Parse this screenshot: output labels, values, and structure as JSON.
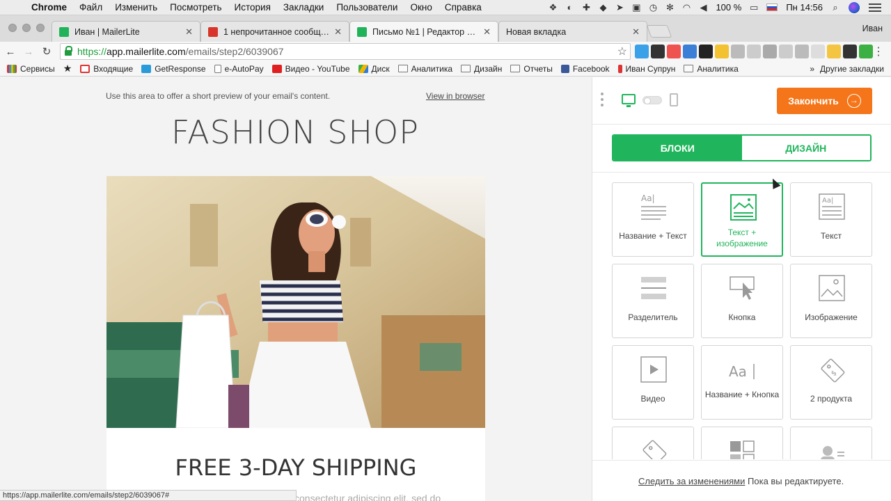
{
  "menubar": {
    "app": "Chrome",
    "items": [
      "Файл",
      "Изменить",
      "Посмотреть",
      "История",
      "Закладки",
      "Пользователи",
      "Окно",
      "Справка"
    ],
    "battery": "100 %",
    "clock": "Пн 14:56"
  },
  "tabs": [
    {
      "title": "Иван | MailerLite",
      "color": "#21b35a"
    },
    {
      "title": "1 непрочитанное сообщение",
      "color": "#d9342b"
    },
    {
      "title": "Письмо №1 | Редактор пользователя",
      "color": "#21b35a"
    },
    {
      "title": "Новая вкладка",
      "color": ""
    }
  ],
  "profile": "Иван",
  "url": {
    "scheme": "https://",
    "host": "app.mailerlite.com",
    "path": "/emails/step2/6039067"
  },
  "bookmarks": [
    {
      "label": "Сервисы",
      "color": "#d33"
    },
    {
      "label": "",
      "color": ""
    },
    {
      "label": "Входящие",
      "color": "#d33"
    },
    {
      "label": "GetResponse",
      "color": "#2a9bd8"
    },
    {
      "label": "e-AutoPay",
      "color": ""
    },
    {
      "label": "Видео - YouTube",
      "color": "#e02020"
    },
    {
      "label": "Диск",
      "color": "#f4b400"
    },
    {
      "label": "Аналитика",
      "color": ""
    },
    {
      "label": "Дизайн",
      "color": ""
    },
    {
      "label": "Отчеты",
      "color": ""
    },
    {
      "label": "Facebook",
      "color": "#3b5998"
    },
    {
      "label": "Иван Супрун",
      "color": "#d33"
    },
    {
      "label": "Аналитика",
      "color": ""
    }
  ],
  "bookmarks_more": "Другие закладки",
  "email": {
    "preheader": "Use this area to offer a short preview of your email's content.",
    "view_in_browser": "View in browser",
    "brand": "FASHION SHOP",
    "headline": "FREE 3-DAY SHIPPING",
    "body_partial": "consectetur adipiscing elit, sed do"
  },
  "status_url": "https://app.mailerlite.com/emails/step2/6039067#",
  "panel": {
    "finish_label": "Закончить",
    "tab_blocks": "БЛОКИ",
    "tab_design": "ДИЗАЙН",
    "blocks": [
      {
        "label": "Название + Текст",
        "icon": "title-text-icon"
      },
      {
        "label": "Текст + изображение",
        "icon": "text-image-icon",
        "selected": true
      },
      {
        "label": "Текст",
        "icon": "text-icon"
      },
      {
        "label": "Разделитель",
        "icon": "divider-icon"
      },
      {
        "label": "Кнопка",
        "icon": "button-icon"
      },
      {
        "label": "Изображение",
        "icon": "image-icon"
      },
      {
        "label": "Видео",
        "icon": "video-icon"
      },
      {
        "label": "Название + Кнопка",
        "icon": "title-button-icon"
      },
      {
        "label": "2 продукта",
        "icon": "two-products-icon"
      },
      {
        "label": "",
        "icon": "product-icon"
      },
      {
        "label": "",
        "icon": "social-icon"
      },
      {
        "label": "",
        "icon": "person-icon"
      }
    ],
    "track_link": "Следить за изменениями",
    "track_text": "Пока вы редактируете."
  },
  "colors": {
    "accent": "#20b55c",
    "finish": "#f5761a"
  }
}
